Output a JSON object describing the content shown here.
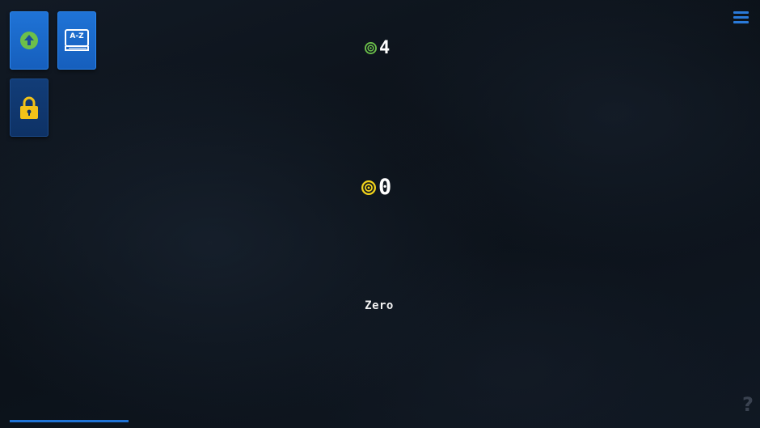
{
  "sidebar": {
    "tiles": [
      {
        "name": "upgrade",
        "icon": "arrow-up-circle-icon"
      },
      {
        "name": "dictionary",
        "icon": "book-icon",
        "label": "A-Z"
      },
      {
        "name": "lock",
        "icon": "padlock-icon"
      }
    ]
  },
  "header": {
    "menu_icon": "hamburger-menu-icon"
  },
  "scores": {
    "bonus": {
      "value": "4",
      "icon": "green-target-coin-icon",
      "color": "#6cc04a"
    },
    "coins": {
      "value": "0",
      "icon": "yellow-target-coin-icon",
      "color": "#f2d31b"
    }
  },
  "word": {
    "text": "Zero"
  },
  "footer": {
    "help_label": "?",
    "progress_fraction": 0.16
  },
  "colors": {
    "accent_blue": "#1f73d6",
    "background": "#0d131c",
    "lock_yellow": "#f2c218"
  }
}
